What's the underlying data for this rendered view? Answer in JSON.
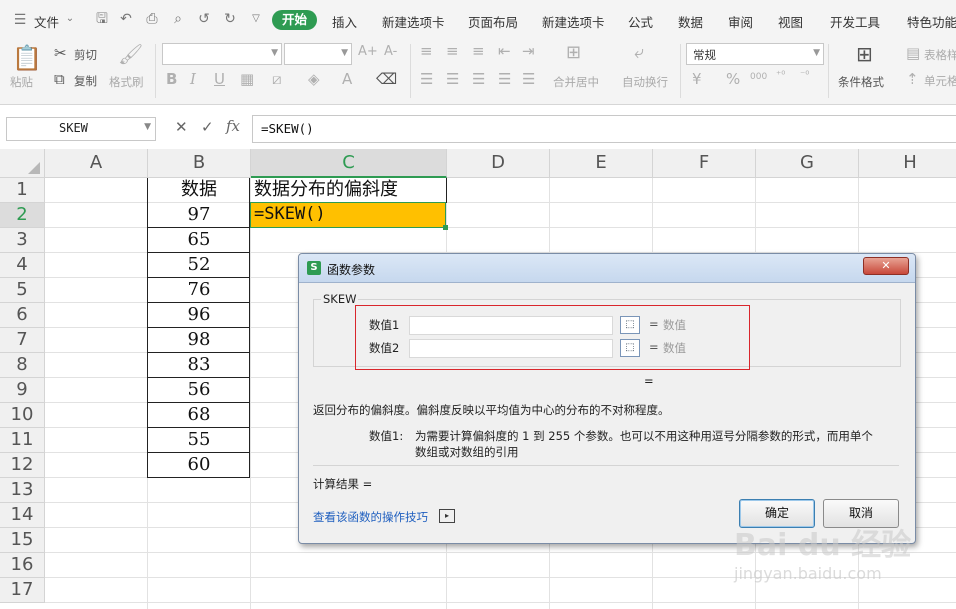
{
  "menubar": {
    "file": "文件",
    "tabs": [
      "开始",
      "插入",
      "新建选项卡",
      "页面布局",
      "新建选项卡",
      "公式",
      "数据",
      "审阅",
      "视图",
      "开发工具",
      "特色功能"
    ],
    "active_tab": "开始"
  },
  "ribbon": {
    "paste": "粘贴",
    "cut": "剪切",
    "copy": "复制",
    "format_painter": "格式刷",
    "bold": "B",
    "italic": "I",
    "underline": "U",
    "font_grow": "A+",
    "font_shrink": "A-",
    "merge_center": "合并居中",
    "wrap_text": "自动换行",
    "number_format": "常规",
    "currency": "¥",
    "percent": "%",
    "thousands": "000",
    "conditional_format": "条件格式",
    "table_style": "表格样",
    "cell": "单元格"
  },
  "formula_bar": {
    "name_box": "SKEW",
    "fx": "fx",
    "formula": "=SKEW()"
  },
  "grid": {
    "columns": [
      "A",
      "B",
      "C",
      "D",
      "E",
      "F",
      "G",
      "H"
    ],
    "rows": [
      "1",
      "2",
      "3",
      "4",
      "5",
      "6",
      "7",
      "8",
      "9",
      "10",
      "11",
      "12",
      "13",
      "14",
      "15",
      "16",
      "17"
    ],
    "header_B": "数据",
    "header_C": "数据分布的偏斜度",
    "values": [
      "97",
      "65",
      "52",
      "76",
      "96",
      "98",
      "83",
      "56",
      "68",
      "55",
      "60"
    ],
    "active_cell_text": "=SKEW()"
  },
  "dialog": {
    "title": "函数参数",
    "function_name": "SKEW",
    "param1_label": "数值1",
    "param2_label": "数值2",
    "eq": "=",
    "param_hint": "数值",
    "description": "返回分布的偏斜度。偏斜度反映以平均值为中心的分布的不对称程度。",
    "param_desc_label": "数值1:",
    "param_desc_line1": "为需要计算偏斜度的 1 到 255 个参数。也可以不用这种用逗号分隔参数的形式，而用单个",
    "param_desc_line2": "数组或对数组的引用",
    "result_label": "计算结果 =",
    "help_link": "查看该函数的操作技巧",
    "ok": "确定",
    "cancel": "取消",
    "close": "✕"
  },
  "watermark": {
    "brand": "Bai du 经验",
    "url": "jingyan.baidu.com"
  },
  "colors": {
    "accent_green": "#2e9b52",
    "active_cell_fill": "#ffc000",
    "highlight_box": "#d9262c",
    "link_blue": "#1f5fbf"
  }
}
